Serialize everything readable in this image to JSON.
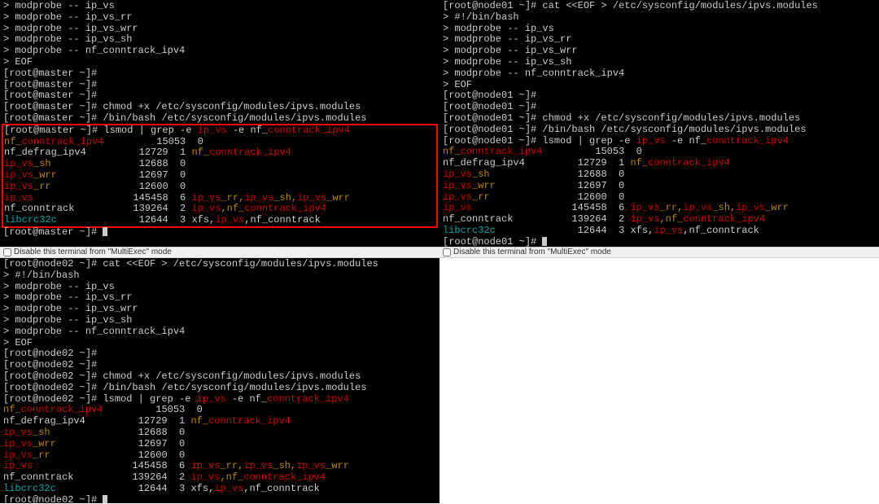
{
  "multiexec_label": "Disable this terminal from \"MultiExec\" mode",
  "panes": [
    {
      "id": "p0",
      "has_bar_before": false,
      "host": "master",
      "prompt": "[root@master ~]#",
      "pre_lines": [
        {
          "segs": [
            {
              "t": "> modprobe -- ip_vs"
            }
          ]
        },
        {
          "segs": [
            {
              "t": "> modprobe -- ip_vs_rr"
            }
          ]
        },
        {
          "segs": [
            {
              "t": "> modprobe -- ip_vs_wrr"
            }
          ]
        },
        {
          "segs": [
            {
              "t": "> modprobe -- ip_vs_sh"
            }
          ]
        },
        {
          "segs": [
            {
              "t": "> modprobe -- nf_conntrack_ipv4"
            }
          ]
        },
        {
          "segs": [
            {
              "t": "> EOF"
            }
          ]
        },
        {
          "segs": [
            {
              "t": "[root@master ~]#"
            }
          ]
        },
        {
          "segs": [
            {
              "t": "[root@master ~]#"
            }
          ]
        },
        {
          "segs": [
            {
              "t": "[root@master ~]#"
            }
          ]
        },
        {
          "segs": [
            {
              "t": "[root@master ~]# chmod +x /etc/sysconfig/modules/ipvs.modules"
            }
          ]
        },
        {
          "segs": [
            {
              "t": "[root@master ~]# /bin/bash /etc/sysconfig/modules/ipvs.modules"
            }
          ]
        }
      ],
      "boxed_lines": [
        {
          "segs": [
            {
              "t": "[root@master ~]# lsmod | grep -e "
            },
            {
              "t": "ip_vs",
              "c": "red"
            },
            {
              "t": " -e nf_"
            },
            {
              "t": "conntrack_ipv4",
              "c": "red"
            }
          ]
        },
        {
          "segs": [
            {
              "t": "nf_",
              "c": "orange"
            },
            {
              "t": "conntrack_ipv4",
              "c": "red"
            },
            {
              "t": "         15053  0"
            }
          ]
        },
        {
          "segs": [
            {
              "t": "nf_defrag_ipv4         12729  1 "
            },
            {
              "t": "nf_",
              "c": "orange"
            },
            {
              "t": "conntrack_ipv4",
              "c": "red"
            }
          ]
        },
        {
          "segs": [
            {
              "t": "ip_vs",
              "c": "red"
            },
            {
              "t": "_sh",
              "c": "orange"
            },
            {
              "t": "               12688  0"
            }
          ]
        },
        {
          "segs": [
            {
              "t": "ip_vs",
              "c": "red"
            },
            {
              "t": "_wrr",
              "c": "orange"
            },
            {
              "t": "              12697  0"
            }
          ]
        },
        {
          "segs": [
            {
              "t": "ip_vs",
              "c": "red"
            },
            {
              "t": "_rr",
              "c": "orange"
            },
            {
              "t": "               12600  0"
            }
          ]
        },
        {
          "segs": [
            {
              "t": "ip_vs",
              "c": "red"
            },
            {
              "t": "                 145458  6 "
            },
            {
              "t": "ip_vs",
              "c": "red"
            },
            {
              "t": "_rr,",
              "c": "orange"
            },
            {
              "t": "ip_vs",
              "c": "red"
            },
            {
              "t": "_sh,",
              "c": "orange"
            },
            {
              "t": "ip_vs",
              "c": "red"
            },
            {
              "t": "_wrr",
              "c": "orange"
            }
          ]
        },
        {
          "segs": [
            {
              "t": "nf_conntrack          139264  2 "
            },
            {
              "t": "ip_vs",
              "c": "red"
            },
            {
              "t": ",",
              "c": "orange"
            },
            {
              "t": "nf_",
              "c": "orange"
            },
            {
              "t": "conntrack_ipv4",
              "c": "red"
            }
          ]
        },
        {
          "segs": [
            {
              "t": "libcrc32c",
              "c": "cyan"
            },
            {
              "t": "              12644  3 xfs,"
            },
            {
              "t": "ip_vs",
              "c": "red"
            },
            {
              "t": ",nf_conntrack"
            }
          ]
        }
      ],
      "post_lines": [
        {
          "segs": [
            {
              "t": "[root@master ~]# "
            }
          ],
          "caret": true
        }
      ]
    },
    {
      "id": "p1",
      "has_bar_before": false,
      "host": "node01",
      "prompt": "[root@node01 ~]#",
      "lines": [
        {
          "segs": [
            {
              "t": "[root@node01 ~]# cat <<EOF > /etc/sysconfig/modules/ipvs.modules"
            }
          ]
        },
        {
          "segs": [
            {
              "t": "> #!/bin/bash"
            }
          ]
        },
        {
          "segs": [
            {
              "t": "> modprobe -- ip_vs"
            }
          ]
        },
        {
          "segs": [
            {
              "t": "> modprobe -- ip_vs_rr"
            }
          ]
        },
        {
          "segs": [
            {
              "t": "> modprobe -- ip_vs_wrr"
            }
          ]
        },
        {
          "segs": [
            {
              "t": "> modprobe -- ip_vs_sh"
            }
          ]
        },
        {
          "segs": [
            {
              "t": "> modprobe -- nf_conntrack_ipv4"
            }
          ]
        },
        {
          "segs": [
            {
              "t": "> EOF"
            }
          ]
        },
        {
          "segs": [
            {
              "t": "[root@node01 ~]#"
            }
          ]
        },
        {
          "segs": [
            {
              "t": "[root@node01 ~]#"
            }
          ]
        },
        {
          "segs": [
            {
              "t": "[root@node01 ~]# chmod +x /etc/sysconfig/modules/ipvs.modules"
            }
          ]
        },
        {
          "segs": [
            {
              "t": "[root@node01 ~]# /bin/bash /etc/sysconfig/modules/ipvs.modules"
            }
          ]
        },
        {
          "segs": [
            {
              "t": "[root@node01 ~]# lsmod | grep -e "
            },
            {
              "t": "ip_vs",
              "c": "red"
            },
            {
              "t": " -e nf_"
            },
            {
              "t": "conntrack_ipv4",
              "c": "red"
            }
          ]
        },
        {
          "segs": [
            {
              "t": "nf_",
              "c": "orange"
            },
            {
              "t": "conntrack_ipv4",
              "c": "red"
            },
            {
              "t": "         15053  0"
            }
          ]
        },
        {
          "segs": [
            {
              "t": "nf_defrag_ipv4         12729  1 "
            },
            {
              "t": "nf_",
              "c": "orange"
            },
            {
              "t": "conntrack_ipv4",
              "c": "red"
            }
          ]
        },
        {
          "segs": [
            {
              "t": "ip_vs",
              "c": "red"
            },
            {
              "t": "_sh",
              "c": "orange"
            },
            {
              "t": "               12688  0"
            }
          ]
        },
        {
          "segs": [
            {
              "t": "ip_vs",
              "c": "red"
            },
            {
              "t": "_wrr",
              "c": "orange"
            },
            {
              "t": "              12697  0"
            }
          ]
        },
        {
          "segs": [
            {
              "t": "ip_vs",
              "c": "red"
            },
            {
              "t": "_rr",
              "c": "orange"
            },
            {
              "t": "               12600  0"
            }
          ]
        },
        {
          "segs": [
            {
              "t": "ip_vs",
              "c": "red"
            },
            {
              "t": "                 145458  6 "
            },
            {
              "t": "ip_vs",
              "c": "red"
            },
            {
              "t": "_rr,",
              "c": "orange"
            },
            {
              "t": "ip_vs",
              "c": "red"
            },
            {
              "t": "_sh,",
              "c": "orange"
            },
            {
              "t": "ip_vs",
              "c": "red"
            },
            {
              "t": "_wrr",
              "c": "orange"
            }
          ]
        },
        {
          "segs": [
            {
              "t": "nf_conntrack          139264  2 "
            },
            {
              "t": "ip_vs",
              "c": "red"
            },
            {
              "t": ",",
              "c": "orange"
            },
            {
              "t": "nf_",
              "c": "orange"
            },
            {
              "t": "conntrack_ipv4",
              "c": "red"
            }
          ]
        },
        {
          "segs": [
            {
              "t": "libcrc32c",
              "c": "cyan"
            },
            {
              "t": "              12644  3 xfs,"
            },
            {
              "t": "ip_vs",
              "c": "red"
            },
            {
              "t": ",nf_conntrack"
            }
          ]
        },
        {
          "segs": [
            {
              "t": "[root@node01 ~]# "
            }
          ],
          "caret": true
        }
      ]
    },
    {
      "id": "p2",
      "has_bar_before": true,
      "host": "node02",
      "prompt": "[root@node02 ~]#",
      "lines": [
        {
          "segs": [
            {
              "t": "[root@node02 ~]# cat <<EOF > /etc/sysconfig/modules/ipvs.modules"
            }
          ]
        },
        {
          "segs": [
            {
              "t": "> #!/bin/bash"
            }
          ]
        },
        {
          "segs": [
            {
              "t": "> modprobe -- ip_vs"
            }
          ]
        },
        {
          "segs": [
            {
              "t": "> modprobe -- ip_vs_rr"
            }
          ]
        },
        {
          "segs": [
            {
              "t": "> modprobe -- ip_vs_wrr"
            }
          ]
        },
        {
          "segs": [
            {
              "t": "> modprobe -- ip_vs_sh"
            }
          ]
        },
        {
          "segs": [
            {
              "t": "> modprobe -- nf_conntrack_ipv4"
            }
          ]
        },
        {
          "segs": [
            {
              "t": "> EOF"
            }
          ]
        },
        {
          "segs": [
            {
              "t": "[root@node02 ~]#"
            }
          ]
        },
        {
          "segs": [
            {
              "t": "[root@node02 ~]#"
            }
          ]
        },
        {
          "segs": [
            {
              "t": "[root@node02 ~]# chmod +x /etc/sysconfig/modules/ipvs.modules"
            }
          ]
        },
        {
          "segs": [
            {
              "t": "[root@node02 ~]# /bin/bash /etc/sysconfig/modules/ipvs.modules"
            }
          ]
        },
        {
          "segs": [
            {
              "t": "[root@node02 ~]# lsmod | grep -e "
            },
            {
              "t": "ip_vs",
              "c": "red"
            },
            {
              "t": " -e nf_"
            },
            {
              "t": "conntrack_ipv4",
              "c": "red"
            }
          ]
        },
        {
          "segs": [
            {
              "t": "nf_",
              "c": "orange"
            },
            {
              "t": "conntrack_ipv4",
              "c": "red"
            },
            {
              "t": "         15053  0"
            }
          ]
        },
        {
          "segs": [
            {
              "t": "nf_defrag_ipv4         12729  1 "
            },
            {
              "t": "nf_",
              "c": "orange"
            },
            {
              "t": "conntrack_ipv4",
              "c": "red"
            }
          ]
        },
        {
          "segs": [
            {
              "t": "ip_vs",
              "c": "red"
            },
            {
              "t": "_sh",
              "c": "orange"
            },
            {
              "t": "               12688  0"
            }
          ]
        },
        {
          "segs": [
            {
              "t": "ip_vs",
              "c": "red"
            },
            {
              "t": "_wrr",
              "c": "orange"
            },
            {
              "t": "              12697  0"
            }
          ]
        },
        {
          "segs": [
            {
              "t": "ip_vs",
              "c": "red"
            },
            {
              "t": "_rr",
              "c": "orange"
            },
            {
              "t": "               12600  0"
            }
          ]
        },
        {
          "segs": [
            {
              "t": "ip_vs",
              "c": "red"
            },
            {
              "t": "                 145458  6 "
            },
            {
              "t": "ip_vs",
              "c": "red"
            },
            {
              "t": "_rr,",
              "c": "orange"
            },
            {
              "t": "ip_vs",
              "c": "red"
            },
            {
              "t": "_sh,",
              "c": "orange"
            },
            {
              "t": "ip_vs",
              "c": "red"
            },
            {
              "t": "_wrr",
              "c": "orange"
            }
          ]
        },
        {
          "segs": [
            {
              "t": "nf_conntrack          139264  2 "
            },
            {
              "t": "ip_vs",
              "c": "red"
            },
            {
              "t": ",",
              "c": "orange"
            },
            {
              "t": "nf_",
              "c": "orange"
            },
            {
              "t": "conntrack_ipv4",
              "c": "red"
            }
          ]
        },
        {
          "segs": [
            {
              "t": "libcrc32c",
              "c": "cyan"
            },
            {
              "t": "              12644  3 xfs,"
            },
            {
              "t": "ip_vs",
              "c": "red"
            },
            {
              "t": ",nf_conntrack"
            }
          ]
        },
        {
          "segs": [
            {
              "t": "[root@node02 ~]# "
            }
          ],
          "caret": true
        }
      ]
    },
    {
      "id": "p3",
      "has_bar_before": true,
      "empty": true
    }
  ]
}
